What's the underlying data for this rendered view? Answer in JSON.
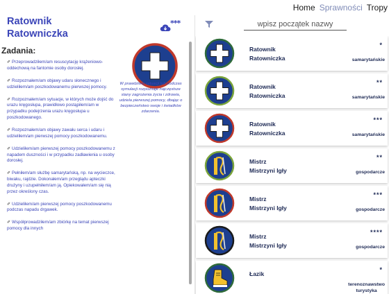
{
  "nav": {
    "home": "Home",
    "sprawnosci": "Sprawności",
    "tropy": "Tropy"
  },
  "left": {
    "title_line1": "Ratownik",
    "title_line2": "Ratowniczka",
    "more": "***",
    "section": "Zadania:",
    "description": "W prawdziwej sytuacji lub podczas symulacji rozpoznaje najczęstsze stany zagrożenia życia i zdrowia, udziela pierwszej pomocy, dbając o bezpieczeństwo swoje i świadków zdarzenia.",
    "tasks": [
      "Przeprowadziłem/am resuscytację krążeniowo-oddechową na fantomie osoby dorosłej.",
      "Rozpoznałem/am objawy udaru słonecznego i udzieliłem/am poszkodowanemu pierwszej pomocy.",
      "Rozpoznałem/am sytuacje, w których może dojść do urazu kręgosłupa, prawidłowo postąpiłem/am w przypadku podejrzenia urazu kręgosłupa u poszkodowanego.",
      "Rozpoznałem/am objawy zawału serca i udaru i udzieliłem/am pierwszej pomocy poszkodowanemu.",
      "Udzieliłem/am pierwszej pomocy poszkodowanemu z napadem duszności i w przypadku zadławienia u osoby dorosłej.",
      "Pełniłem/am służbę samarytańską, np. na wycieczce, biwaku, rajdzie. Dokonałem/am przeglądu apteczki drużyny i uzupełniłem/am ją. Opiekowałem/am się nią przez określony czas.",
      "Udzieliłem/am pierwszej pomocy poszkodowanemu podczas napadu drgawek.",
      "Współprowadziłem/am zbiórkę na temat pierwszej pomocy dla innych"
    ]
  },
  "search": {
    "placeholder": "wpisz początek nazwy"
  },
  "list": [
    {
      "line1": "Ratownik",
      "line2": "Ratowniczka",
      "stars": "*",
      "cat1": "samarytańskie",
      "cat2": "",
      "icon": "medical-cross-icon",
      "ring": "#2f6b3a"
    },
    {
      "line1": "Ratownik",
      "line2": "Ratowniczka",
      "stars": "**",
      "cat1": "samarytańskie",
      "cat2": "",
      "icon": "medical-cross-icon",
      "ring": "#7aa43a"
    },
    {
      "line1": "Ratownik",
      "line2": "Ratowniczka",
      "stars": "***",
      "cat1": "samarytańskie",
      "cat2": "",
      "icon": "medical-cross-icon",
      "ring": "#c0392b"
    },
    {
      "line1": "Mistrz",
      "line2": "Mistrzyni Igły",
      "stars": "**",
      "cat1": "gospodarcze",
      "cat2": "",
      "icon": "needle-thread-icon",
      "ring": "#7aa43a"
    },
    {
      "line1": "Mistrz",
      "line2": "Mistrzyni Igły",
      "stars": "***",
      "cat1": "gospodarcze",
      "cat2": "",
      "icon": "needle-thread-icon",
      "ring": "#c0392b"
    },
    {
      "line1": "Mistrz",
      "line2": "Mistrzyni Igły",
      "stars": "****",
      "cat1": "gospodarcze",
      "cat2": "",
      "icon": "needle-thread-icon",
      "ring": "#1a1a1a"
    },
    {
      "line1": "Łazik",
      "line2": "",
      "stars": "*",
      "cat1": "terenoznawstwo",
      "cat2": "turystyka",
      "icon": "hiking-boot-icon",
      "ring": "#2f6b3a"
    }
  ],
  "colors": {
    "accent": "#3b45b8",
    "dark": "#1e2a55",
    "badge_blue": "#1d3f8f",
    "ring_red": "#c0392b"
  }
}
